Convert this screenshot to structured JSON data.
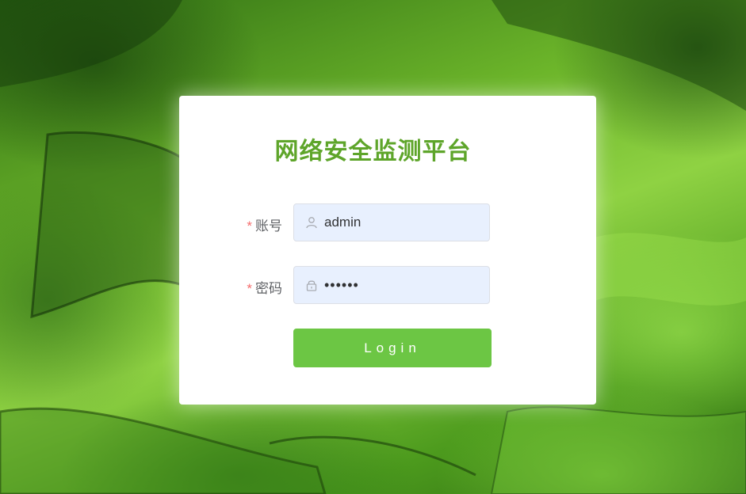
{
  "login": {
    "title": "网络安全监测平台",
    "required_mark": "*",
    "account_label": "账号",
    "account_value": "admin",
    "password_label": "密码",
    "password_value": "123456",
    "submit_label": "Login"
  },
  "icons": {
    "account": "user-icon",
    "password": "lock-icon"
  },
  "colors": {
    "title": "#5ea52a",
    "button": "#6cc644",
    "input_background": "#e8f0fe",
    "required": "#f56c6c"
  }
}
